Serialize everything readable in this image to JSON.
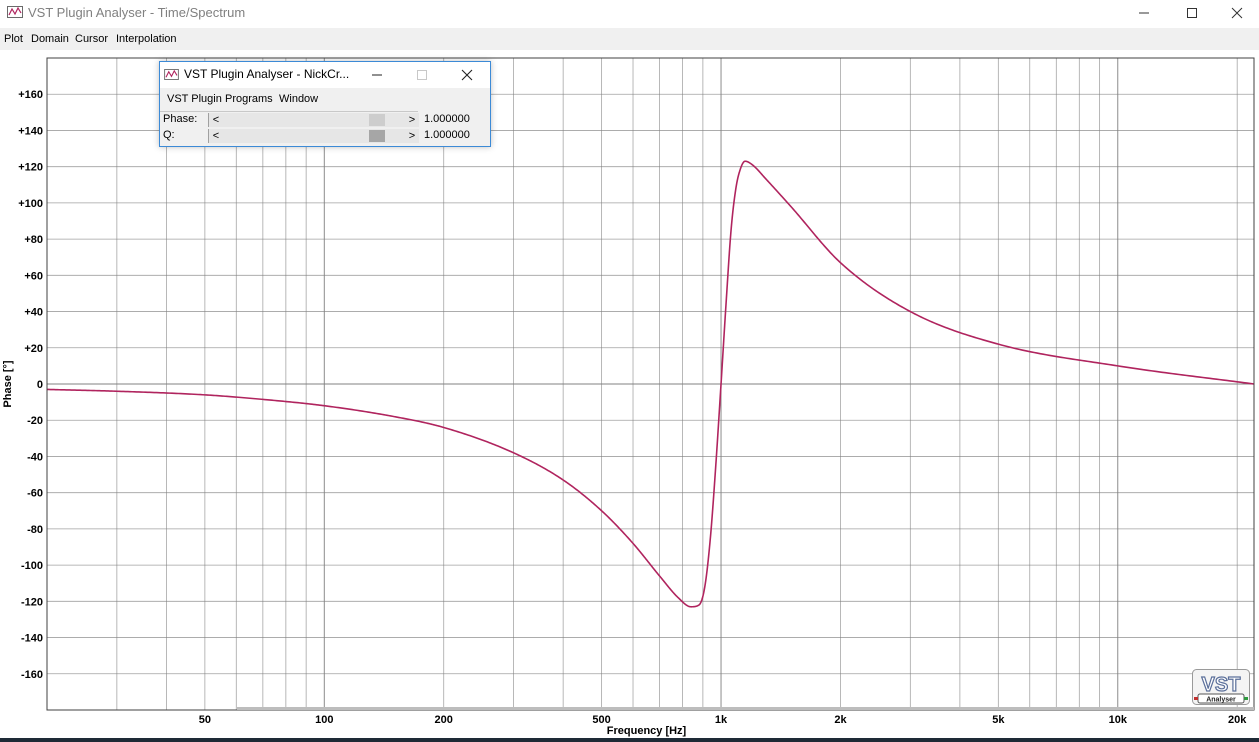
{
  "window": {
    "title": "VST Plugin Analyser - Time/Spectrum",
    "controls": {
      "minimize": "—",
      "maximize": "☐",
      "close": "✕"
    }
  },
  "menu": {
    "items": [
      "Plot",
      "Domain",
      "Cursor",
      "Interpolation"
    ]
  },
  "plugin_window": {
    "title": "VST Plugin Analyser - NickCr...",
    "menu": [
      "VST Plugin",
      "Programs",
      "Window"
    ],
    "params": [
      {
        "label": "Phase:",
        "value": "1.000000",
        "position": 0.88
      },
      {
        "label": "Q:",
        "value": "1.000000",
        "position": 0.88
      }
    ]
  },
  "logo": {
    "text": "VST",
    "subtext": "Analyser"
  },
  "colors": {
    "curve": "#b0245e",
    "grid": "#808080",
    "accent": "#3c8ad6"
  },
  "chart_data": {
    "type": "line",
    "xlabel": "Frequency [Hz]",
    "ylabel": "Phase [°]",
    "xscale": "log",
    "xlim": [
      20,
      22050
    ],
    "ylim": [
      -180,
      180
    ],
    "x_ticks": [
      {
        "value": 50,
        "label": "50"
      },
      {
        "value": 100,
        "label": "100"
      },
      {
        "value": 200,
        "label": "200"
      },
      {
        "value": 500,
        "label": "500"
      },
      {
        "value": 1000,
        "label": "1k"
      },
      {
        "value": 2000,
        "label": "2k"
      },
      {
        "value": 5000,
        "label": "5k"
      },
      {
        "value": 10000,
        "label": "10k"
      },
      {
        "value": 20000,
        "label": "20k"
      }
    ],
    "y_ticks": [
      {
        "value": 160,
        "label": "+160"
      },
      {
        "value": 140,
        "label": "+140"
      },
      {
        "value": 120,
        "label": "+120"
      },
      {
        "value": 100,
        "label": "+100"
      },
      {
        "value": 80,
        "label": "+80"
      },
      {
        "value": 60,
        "label": "+60"
      },
      {
        "value": 40,
        "label": "+40"
      },
      {
        "value": 20,
        "label": "+20"
      },
      {
        "value": 0,
        "label": "0"
      },
      {
        "value": -20,
        "label": "-20"
      },
      {
        "value": -40,
        "label": "-40"
      },
      {
        "value": -60,
        "label": "-60"
      },
      {
        "value": -80,
        "label": "-80"
      },
      {
        "value": -100,
        "label": "-100"
      },
      {
        "value": -120,
        "label": "-120"
      },
      {
        "value": -140,
        "label": "-140"
      },
      {
        "value": -160,
        "label": "-160"
      }
    ],
    "grid": true,
    "series": [
      {
        "x": [
          20,
          30,
          50,
          70,
          100,
          150,
          200,
          300,
          400,
          500,
          600,
          700,
          780,
          840,
          880,
          910,
          940,
          970,
          1000,
          1030,
          1060,
          1090,
          1120,
          1150,
          1200,
          1300,
          1500,
          2000,
          3000,
          5000,
          10000,
          22050
        ],
        "y": [
          -3,
          -4,
          -6,
          -8.5,
          -12,
          -18,
          -24,
          -38,
          -53,
          -70,
          -88,
          -106,
          -118,
          -123,
          -122,
          -112,
          -85,
          -45,
          0,
          45,
          85,
          108,
          119,
          123,
          121,
          113,
          98,
          67,
          40,
          22,
          10,
          0
        ]
      }
    ]
  }
}
